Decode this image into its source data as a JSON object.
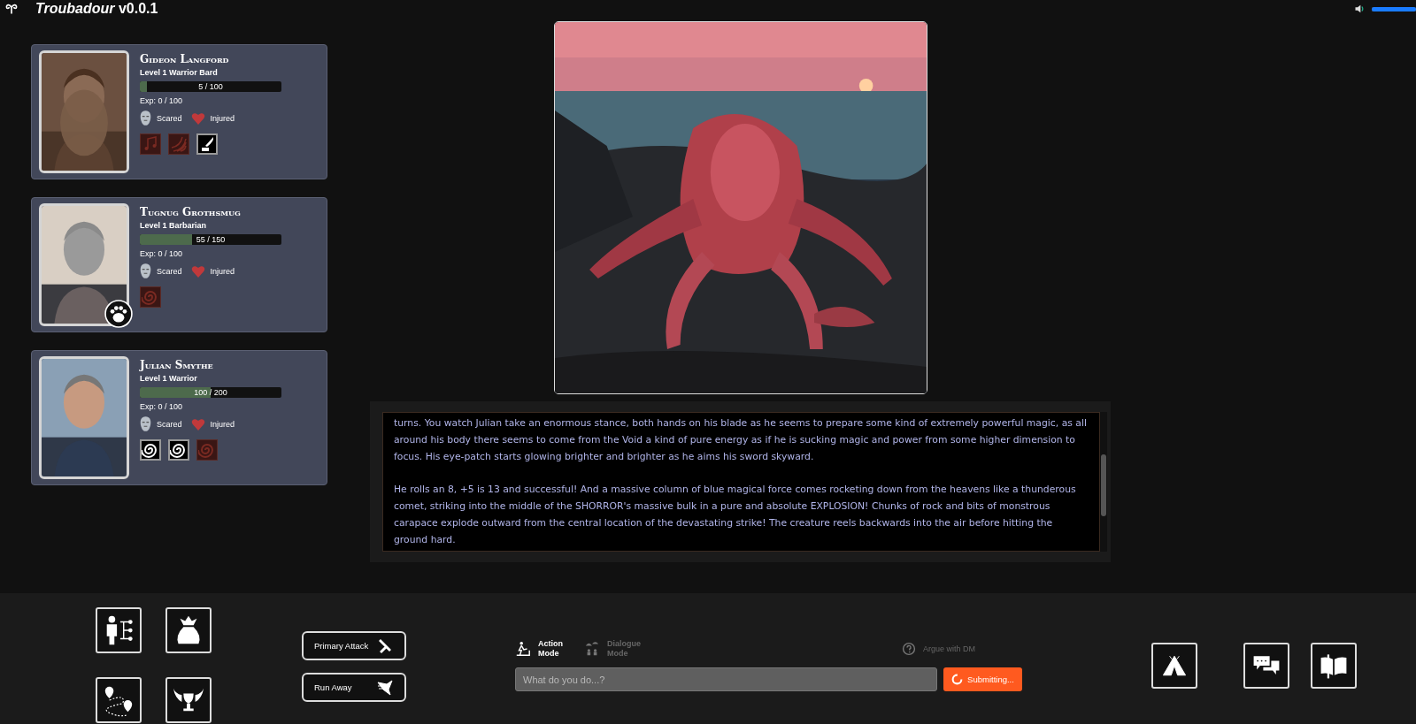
{
  "header": {
    "title": "*Troubadour* v0.0.1",
    "volume": {
      "level": 1
    }
  },
  "party": [
    {
      "name": "Gideon Langford",
      "class": "Level 1 Warrior Bard",
      "hp": "5 / 100",
      "level": 0.05,
      "exp": "Exp: 0 / 100",
      "portrait": {
        "kind": "picture"
      },
      "statuses": [
        {
          "kind": "mask",
          "label": "Scared"
        },
        {
          "kind": "heart",
          "label": "Injured"
        }
      ],
      "abilities": [
        {
          "kind": "music",
          "active": false
        },
        {
          "kind": "waves",
          "active": false
        },
        {
          "kind": "quill",
          "active": true
        }
      ]
    },
    {
      "name": "Tugnug Grothsmug",
      "class": "Level 1 Barbarian",
      "hp": "55 / 150",
      "level": 0.367,
      "exp": "Exp: 0 / 100",
      "portrait": {
        "kind": "picture"
      },
      "badge": {
        "kind": "paw"
      },
      "statuses": [
        {
          "kind": "mask",
          "label": "Scared"
        },
        {
          "kind": "heart",
          "label": "Injured"
        }
      ],
      "abilities": [
        {
          "kind": "spiral",
          "active": false
        }
      ]
    },
    {
      "name": "Julian Smythe",
      "class": "Level 1 Warrior",
      "hp": "100 / 200",
      "level": 0.5,
      "exp": "Exp: 0 / 100",
      "portrait": {
        "kind": "picture"
      },
      "statuses": [
        {
          "kind": "mask",
          "label": "Scared"
        },
        {
          "kind": "heart",
          "label": "Injured"
        }
      ],
      "abilities": [
        {
          "kind": "spiral",
          "active": true
        },
        {
          "kind": "spiral",
          "active": true
        },
        {
          "kind": "spiral",
          "active": false
        }
      ]
    }
  ],
  "scene": {
    "kind": "picture"
  },
  "story": [
    "turns. You watch Julian take an enormous stance, both hands on his blade as he seems to prepare some kind of extremely powerful magic, as all around his body there seems to come from the Void a kind of pure energy as if he is sucking magic and power from some higher dimension to focus. His eye-patch starts glowing brighter and brighter as he aims his sword skyward.",
    "He rolls an 8, +5 is 13 and successful! And a massive column of blue magical force comes rocketing down from the heavens like a thunderous comet, striking into the middle of the SHORROR's massive bulk in a pure and absolute EXPLOSION! Chunks of rock and bits of monstrous carapace explode outward from the central location of the devastating strike! The creature reels backwards into the air before hitting the ground hard."
  ],
  "menu_buttons": [
    {
      "kind": "party"
    },
    {
      "kind": "bag"
    },
    {
      "kind": "map"
    },
    {
      "kind": "chalice"
    }
  ],
  "combat_buttons": [
    {
      "kind": "attack",
      "label": "Primary Attack"
    },
    {
      "kind": "flee",
      "label": "Run Away"
    }
  ],
  "modes": [
    {
      "kind": "action",
      "label": "Action\nMode",
      "selected": true
    },
    {
      "kind": "dialogue",
      "label": "Dialogue\nMode",
      "selected": false
    }
  ],
  "argue": {
    "label": "Argue with DM"
  },
  "input": {
    "placeholder": "What do you do...?"
  },
  "submit": {
    "label": "Submitting...",
    "busy": true
  },
  "right_buttons": [
    {
      "kind": "camp"
    },
    {
      "kind": "chat"
    },
    {
      "kind": "book"
    }
  ]
}
